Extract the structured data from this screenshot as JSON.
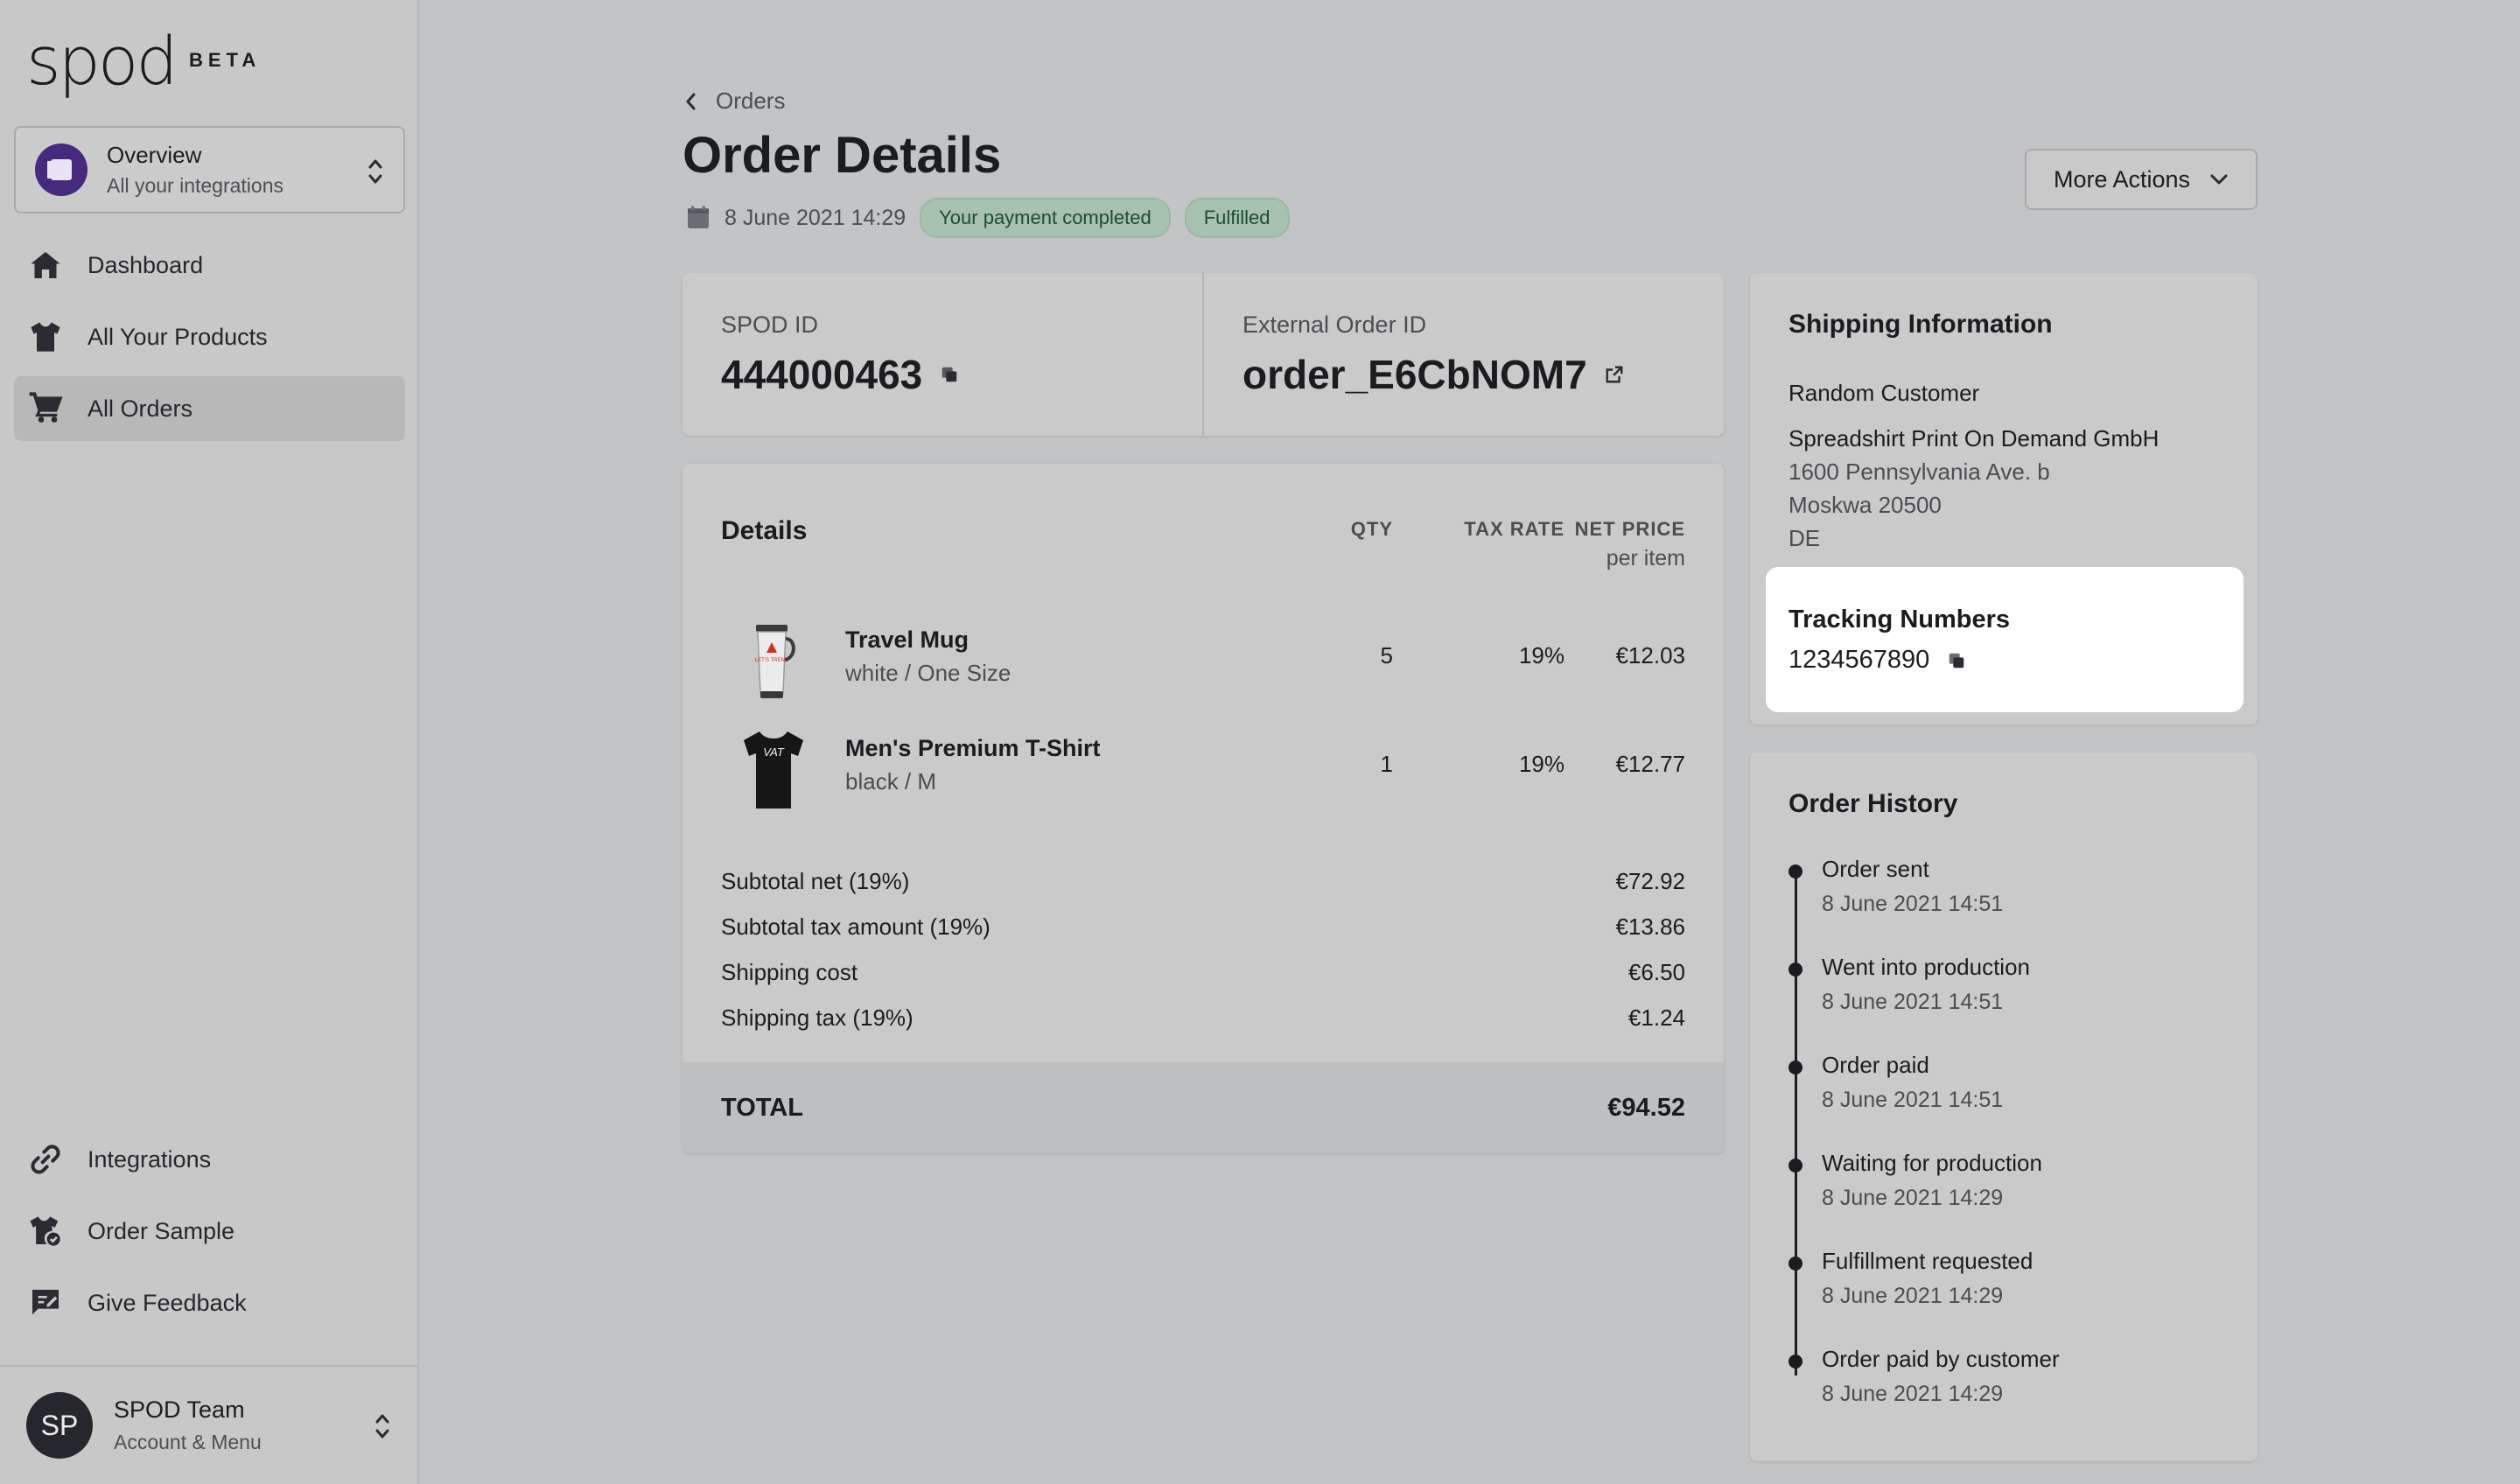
{
  "brand": {
    "logo": "spod",
    "beta": "BETA"
  },
  "switcher": {
    "title": "Overview",
    "subtitle": "All your integrations"
  },
  "nav": {
    "top": [
      {
        "label": "Dashboard",
        "icon": "home-icon"
      },
      {
        "label": "All Your Products",
        "icon": "tshirt-icon"
      },
      {
        "label": "All Orders",
        "icon": "cart-icon",
        "active": true
      }
    ],
    "bottom": [
      {
        "label": "Integrations",
        "icon": "link-icon"
      },
      {
        "label": "Order Sample",
        "icon": "sample-icon"
      },
      {
        "label": "Give Feedback",
        "icon": "feedback-icon"
      }
    ]
  },
  "account": {
    "initials": "SP",
    "name": "SPOD Team",
    "subtitle": "Account & Menu"
  },
  "header": {
    "breadcrumb": "Orders",
    "title": "Order Details",
    "date": "8 June 2021 14:29",
    "badges": [
      "Your payment completed",
      "Fulfilled"
    ],
    "more_actions": "More Actions"
  },
  "ids": {
    "spod_label": "SPOD ID",
    "spod_value": "444000463",
    "external_label": "External Order ID",
    "external_value": "order_E6CbNOM7"
  },
  "details": {
    "title": "Details",
    "columns": {
      "qty": "QTY",
      "tax": "TAX RATE",
      "net": "NET PRICE",
      "net_sub": "per item"
    },
    "items": [
      {
        "name": "Travel Mug",
        "variant": "white / One Size",
        "qty": "5",
        "tax": "19%",
        "net": "€12.03",
        "thumb_text": "LET'S TREND"
      },
      {
        "name": "Men's Premium T-Shirt",
        "variant": "black / M",
        "qty": "1",
        "tax": "19%",
        "net": "€12.77",
        "thumb_text": "VAT"
      }
    ],
    "summary": [
      {
        "label": "Subtotal net (19%)",
        "value": "€72.92"
      },
      {
        "label": "Subtotal tax amount (19%)",
        "value": "€13.86"
      },
      {
        "label": "Shipping cost",
        "value": "€6.50"
      },
      {
        "label": "Shipping tax (19%)",
        "value": "€1.24"
      }
    ],
    "total_label": "TOTAL",
    "total_value": "€94.52"
  },
  "shipping": {
    "title": "Shipping Information",
    "customer": "Random Customer",
    "company": "Spreadshirt Print On Demand GmbH",
    "street": "1600 Pennsylvania Ave. b",
    "city": "Moskwa 20500",
    "country": "DE",
    "tracking_title": "Tracking Numbers",
    "tracking_number": "1234567890"
  },
  "history": {
    "title": "Order History",
    "events": [
      {
        "title": "Order sent",
        "time": "8 June 2021 14:51"
      },
      {
        "title": "Went into production",
        "time": "8 June 2021 14:51"
      },
      {
        "title": "Order paid",
        "time": "8 June 2021 14:51"
      },
      {
        "title": "Waiting for production",
        "time": "8 June 2021 14:29"
      },
      {
        "title": "Fulfillment requested",
        "time": "8 June 2021 14:29"
      },
      {
        "title": "Order paid by customer",
        "time": "8 June 2021 14:29"
      }
    ]
  },
  "colors": {
    "background": "#c3c4c6",
    "sidebar": "#c8c8c8",
    "card": "#cacaca",
    "badge_bg": "#a6c1ae",
    "badge_text": "#1f4c30",
    "switcher_icon": "#452a7d",
    "text": "#1b1c20"
  }
}
